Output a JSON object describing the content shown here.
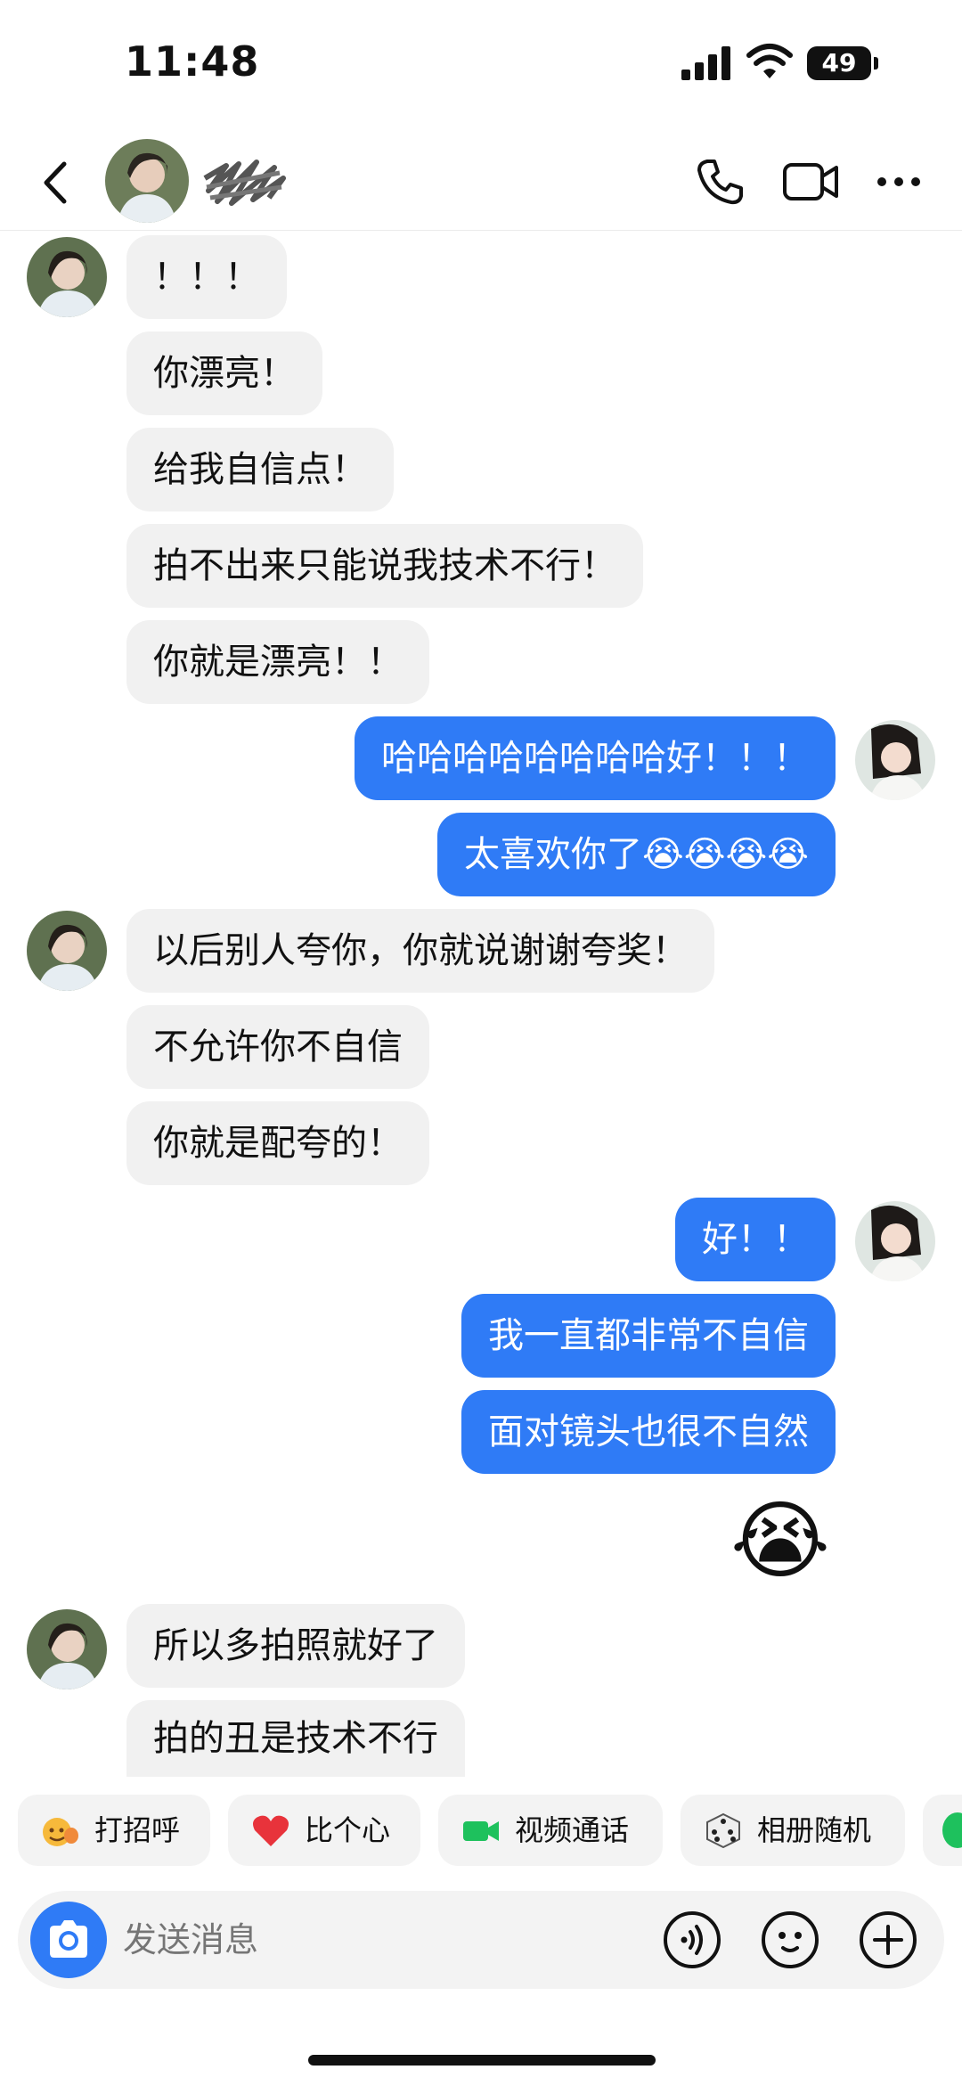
{
  "status_bar": {
    "time": "11:48",
    "battery": "49"
  },
  "header": {
    "back": "back",
    "icons": [
      "phone-icon",
      "video-call-icon",
      "more-icon"
    ]
  },
  "messages": [
    {
      "side": "in",
      "text": "！！！"
    },
    {
      "side": "in",
      "text": "你漂亮！"
    },
    {
      "side": "in",
      "text": "给我自信点！"
    },
    {
      "side": "in",
      "text": "拍不出来只能说我技术不行！"
    },
    {
      "side": "in",
      "text": "你就是漂亮！！"
    },
    {
      "side": "out",
      "text": "哈哈哈哈哈哈哈哈好！！！"
    },
    {
      "side": "out",
      "text": "太喜欢你了😭😭😭😭"
    },
    {
      "side": "in",
      "text": "以后别人夸你，你就说谢谢夸奖！"
    },
    {
      "side": "in",
      "text": "不允许你不自信"
    },
    {
      "side": "in",
      "text": "你就是配夸的！"
    },
    {
      "side": "out",
      "text": "好！！"
    },
    {
      "side": "out",
      "text": "我一直都非常不自信"
    },
    {
      "side": "out",
      "text": "面对镜头也很不自然"
    },
    {
      "side": "out",
      "text": "😭"
    },
    {
      "side": "in",
      "text": "所以多拍照就好了"
    },
    {
      "side": "in",
      "text": "拍的丑是技术不行"
    }
  ],
  "quick_actions": [
    {
      "label": "打招呼",
      "icon": "wave-emoji-icon"
    },
    {
      "label": "比个心",
      "icon": "heart-icon"
    },
    {
      "label": "视频通话",
      "icon": "video-camera-icon"
    },
    {
      "label": "相册随机",
      "icon": "dice-icon"
    }
  ],
  "input": {
    "placeholder": "发送消息"
  },
  "colors": {
    "outgoing_bubble": "#2f7bf6",
    "incoming_bubble": "#f1f1f1"
  }
}
